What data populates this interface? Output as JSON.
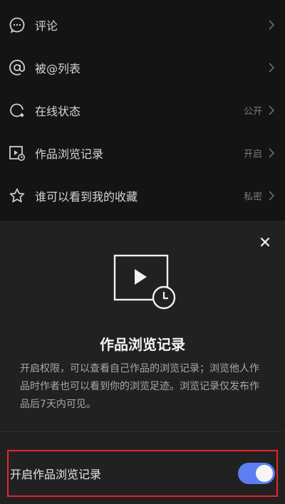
{
  "settings": {
    "items": [
      {
        "icon": "comment-icon",
        "label": "评论",
        "value": ""
      },
      {
        "icon": "at-mention-icon",
        "label": "被@列表",
        "value": ""
      },
      {
        "icon": "online-status-icon",
        "label": "在线状态",
        "value": "公开"
      },
      {
        "icon": "view-history-icon",
        "label": "作品浏览记录",
        "value": "开启"
      },
      {
        "icon": "star-icon",
        "label": "谁可以看到我的收藏",
        "value": "私密"
      }
    ]
  },
  "sheet": {
    "title": "作品浏览记录",
    "description": "开启权限，可以查看自己作品的浏览记录；浏览他人作品时作者也可以看到你的浏览足迹。浏览记录仅发布作品后7天内可见。",
    "toggle_label": "开启作品浏览记录",
    "toggle_on": true
  },
  "colors": {
    "accent": "#5d7ef0",
    "highlight_border": "#e5252f",
    "sheet_bg": "#212121"
  }
}
